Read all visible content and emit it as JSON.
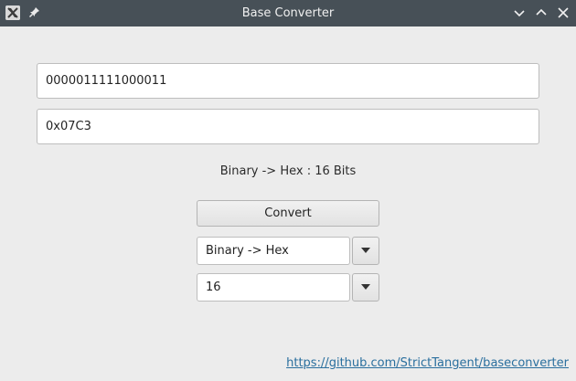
{
  "window": {
    "title": "Base Converter"
  },
  "inputs": {
    "binary_value": "0000011111000011",
    "hex_value": "0x07C3"
  },
  "status": {
    "conversion_info": "Binary -> Hex : 16 Bits"
  },
  "controls": {
    "convert_label": "Convert",
    "mode_selected": "Binary -> Hex",
    "bits_selected": "16"
  },
  "footer": {
    "link_text": "https://github.com/StrictTangent/baseconverter"
  },
  "icons": {
    "app": "app-icon",
    "pin": "pin-icon",
    "minimize": "chevron-down-icon",
    "maximize": "chevron-up-icon",
    "close": "close-icon",
    "dropdown": "triangle-down-icon"
  },
  "colors": {
    "titlebar": "#475057",
    "background": "#ececec",
    "link": "#2a6f9e"
  }
}
